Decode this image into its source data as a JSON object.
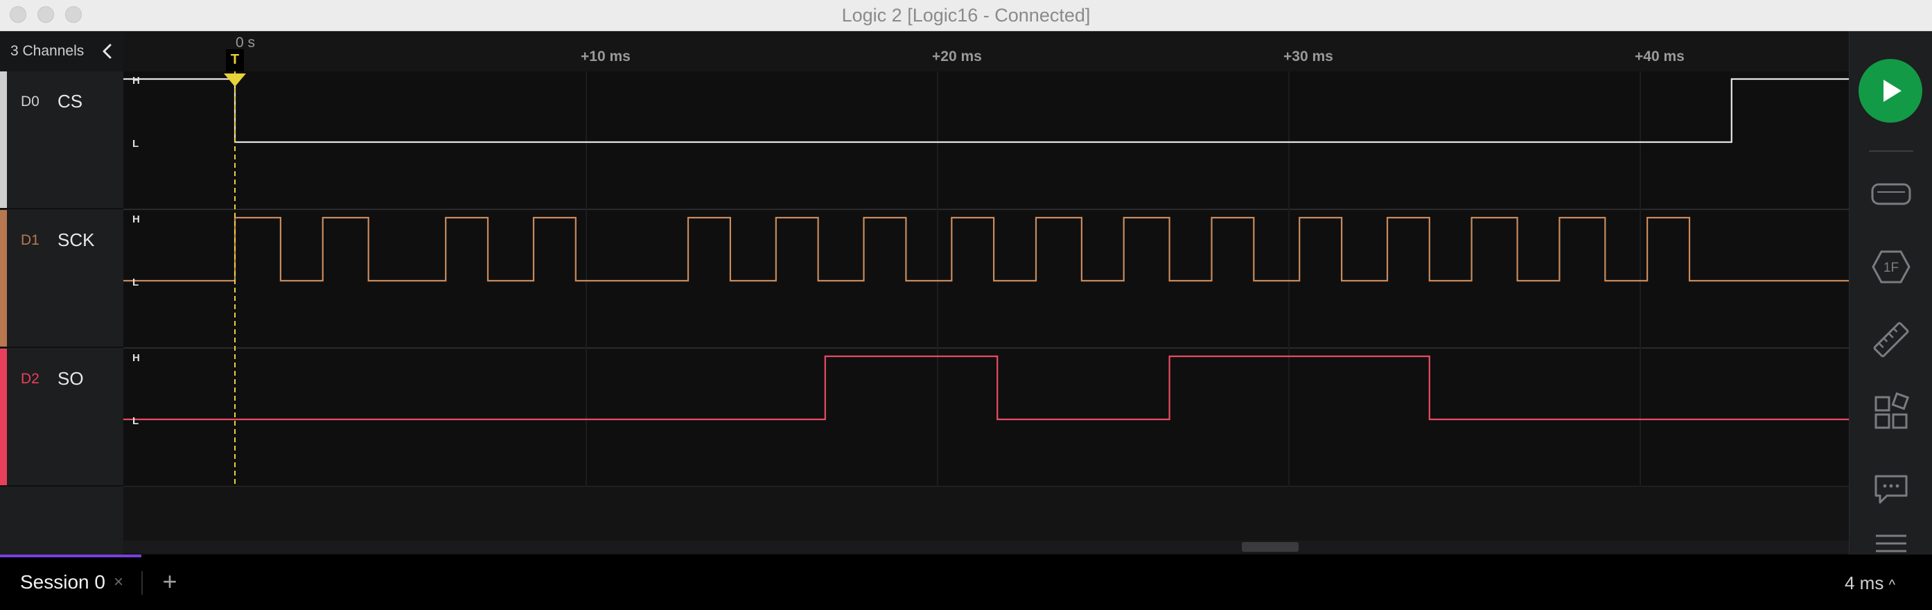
{
  "window": {
    "title": "Logic 2 [Logic16 - Connected]"
  },
  "sidebar": {
    "channel_count": "3 Channels",
    "channels": [
      {
        "id": "D0",
        "name": "CS",
        "color": "#cfcfcf"
      },
      {
        "id": "D1",
        "name": "SCK",
        "color": "#b87850"
      },
      {
        "id": "D2",
        "name": "SO",
        "color": "#e8405a"
      }
    ]
  },
  "timeline": {
    "zero_label": "0 s",
    "trigger_label": "T",
    "ticks": [
      "+10 ms",
      "+20 ms",
      "+30 ms",
      "+40 ms"
    ],
    "level_high": "H",
    "level_low": "L"
  },
  "waveforms": {
    "unit": "ms",
    "visible_range": [
      -6.7,
      45.2
    ],
    "trigger_at": 0,
    "colors": {
      "cs": "#e6e6e6",
      "sck": "#c98b5b",
      "so": "#ec4b63",
      "trigger": "#e8d23a"
    },
    "cs": {
      "initial": 1,
      "transitions": [
        0,
        42.6
      ]
    },
    "sck": {
      "initial": 0,
      "transitions": [
        0,
        1.3,
        2.5,
        3.8,
        6.0,
        7.2,
        8.5,
        9.7,
        12.9,
        14.1,
        15.4,
        16.6,
        17.9,
        19.1,
        20.4,
        21.6,
        22.8,
        24.1,
        25.3,
        26.6,
        27.8,
        29.0,
        30.3,
        31.5,
        32.8,
        34.0,
        35.2,
        36.5,
        37.7,
        39.0,
        40.2,
        41.4
      ]
    },
    "so": {
      "initial": 0,
      "transitions": [
        16.8,
        21.7,
        26.6,
        34.0
      ]
    }
  },
  "rightbar": {
    "run_button": "play-icon",
    "tools": [
      "analyzers-icon",
      "hex-measure-icon",
      "ruler-icon",
      "extensions-icon",
      "notes-icon",
      "menu-icon"
    ]
  },
  "bottombar": {
    "tab_label": "Session 0",
    "tab_close": "×",
    "add_tab": "+",
    "zoom_level": "4 ms",
    "zoom_caret": "^"
  }
}
